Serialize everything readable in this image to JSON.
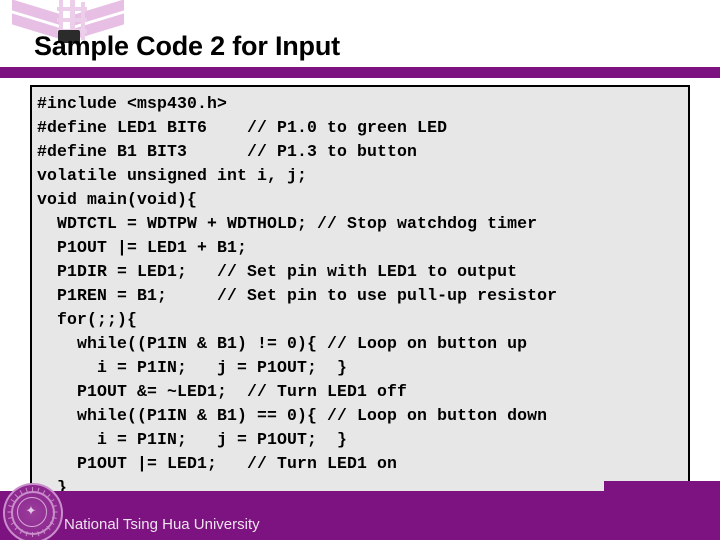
{
  "slide": {
    "title": "Sample Code 2 for Input",
    "accent_color": "#7d1380",
    "logo_color": "#e8bfe4",
    "code_background": "#e7e7e7",
    "code_border": "#000000"
  },
  "logo": {
    "name": "nthu-chevron-logo",
    "alt": "chevron watermark logo"
  },
  "code": {
    "language": "c",
    "lines": [
      "#include <msp430.h>",
      "#define LED1 BIT6    // P1.0 to green LED",
      "#define B1 BIT3      // P1.3 to button",
      "volatile unsigned int i, j;",
      "void main(void){",
      "  WDTCTL = WDTPW + WDTHOLD; // Stop watchdog timer",
      "  P1OUT |= LED1 + B1;",
      "  P1DIR = LED1;   // Set pin with LED1 to output",
      "  P1REN = B1;     // Set pin to use pull-up resistor",
      "  for(;;){",
      "    while((P1IN & B1) != 0){ // Loop on button up",
      "      i = P1IN;   j = P1OUT;  }",
      "    P1OUT &= ~LED1;  // Turn LED1 off",
      "    while((P1IN & B1) == 0){ // Loop on button down",
      "      i = P1IN;   j = P1OUT;  }",
      "    P1OUT |= LED1;   // Turn LED1 on",
      "  }",
      "}"
    ]
  },
  "footer": {
    "organization": "National Tsing Hua University",
    "seal_name": "university-seal"
  }
}
